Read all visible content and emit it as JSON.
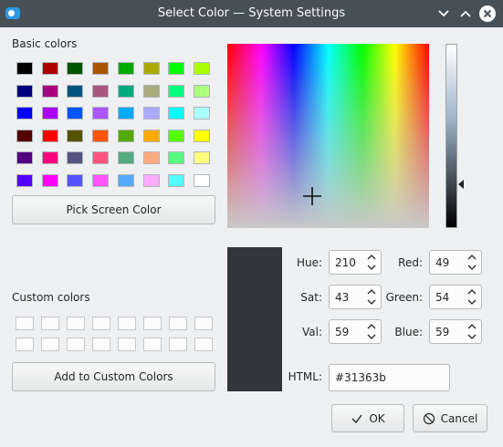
{
  "window": {
    "title": "Select Color — System Settings"
  },
  "basic_colors": {
    "label": "Basic colors",
    "swatches": [
      "#000000",
      "#aa0000",
      "#005500",
      "#aa5500",
      "#00aa00",
      "#aaaa00",
      "#00ff00",
      "#aaff00",
      "#00007f",
      "#aa007f",
      "#00557f",
      "#aa557f",
      "#00aa7f",
      "#aaaa7f",
      "#00ff7f",
      "#aaff7f",
      "#0000ff",
      "#aa00ff",
      "#0055ff",
      "#aa55ff",
      "#00aaff",
      "#aaaaff",
      "#00ffff",
      "#aaffff",
      "#550000",
      "#ff0000",
      "#555500",
      "#ff5500",
      "#55aa00",
      "#ffaa00",
      "#55ff00",
      "#ffff00",
      "#55007f",
      "#ff007f",
      "#55557f",
      "#ff557f",
      "#55aa7f",
      "#ffaa7f",
      "#55ff7f",
      "#ffff7f",
      "#5500ff",
      "#ff00ff",
      "#5555ff",
      "#ff55ff",
      "#55aaff",
      "#ffaaff",
      "#55ffff",
      "#ffffff"
    ]
  },
  "buttons": {
    "pick_screen": "Pick Screen Color",
    "add_custom": "Add to Custom Colors",
    "ok": "OK",
    "cancel": "Cancel"
  },
  "custom_colors": {
    "label": "Custom colors",
    "count": 16
  },
  "fields": {
    "hue": {
      "label": "Hue:",
      "value": "210"
    },
    "sat": {
      "label": "Sat:",
      "value": "43"
    },
    "val": {
      "label": "Val:",
      "value": "59"
    },
    "red": {
      "label": "Red:",
      "value": "49"
    },
    "green": {
      "label": "Green:",
      "value": "54"
    },
    "blue": {
      "label": "Blue:",
      "value": "59"
    },
    "html": {
      "label": "HTML:",
      "value": "#31363b"
    }
  },
  "current_color": "#31363b",
  "icons": {
    "minimize": "chevron-down-icon",
    "maximize": "chevron-up-icon",
    "close": "close-icon",
    "ok": "check-icon",
    "cancel": "cancel-icon"
  }
}
